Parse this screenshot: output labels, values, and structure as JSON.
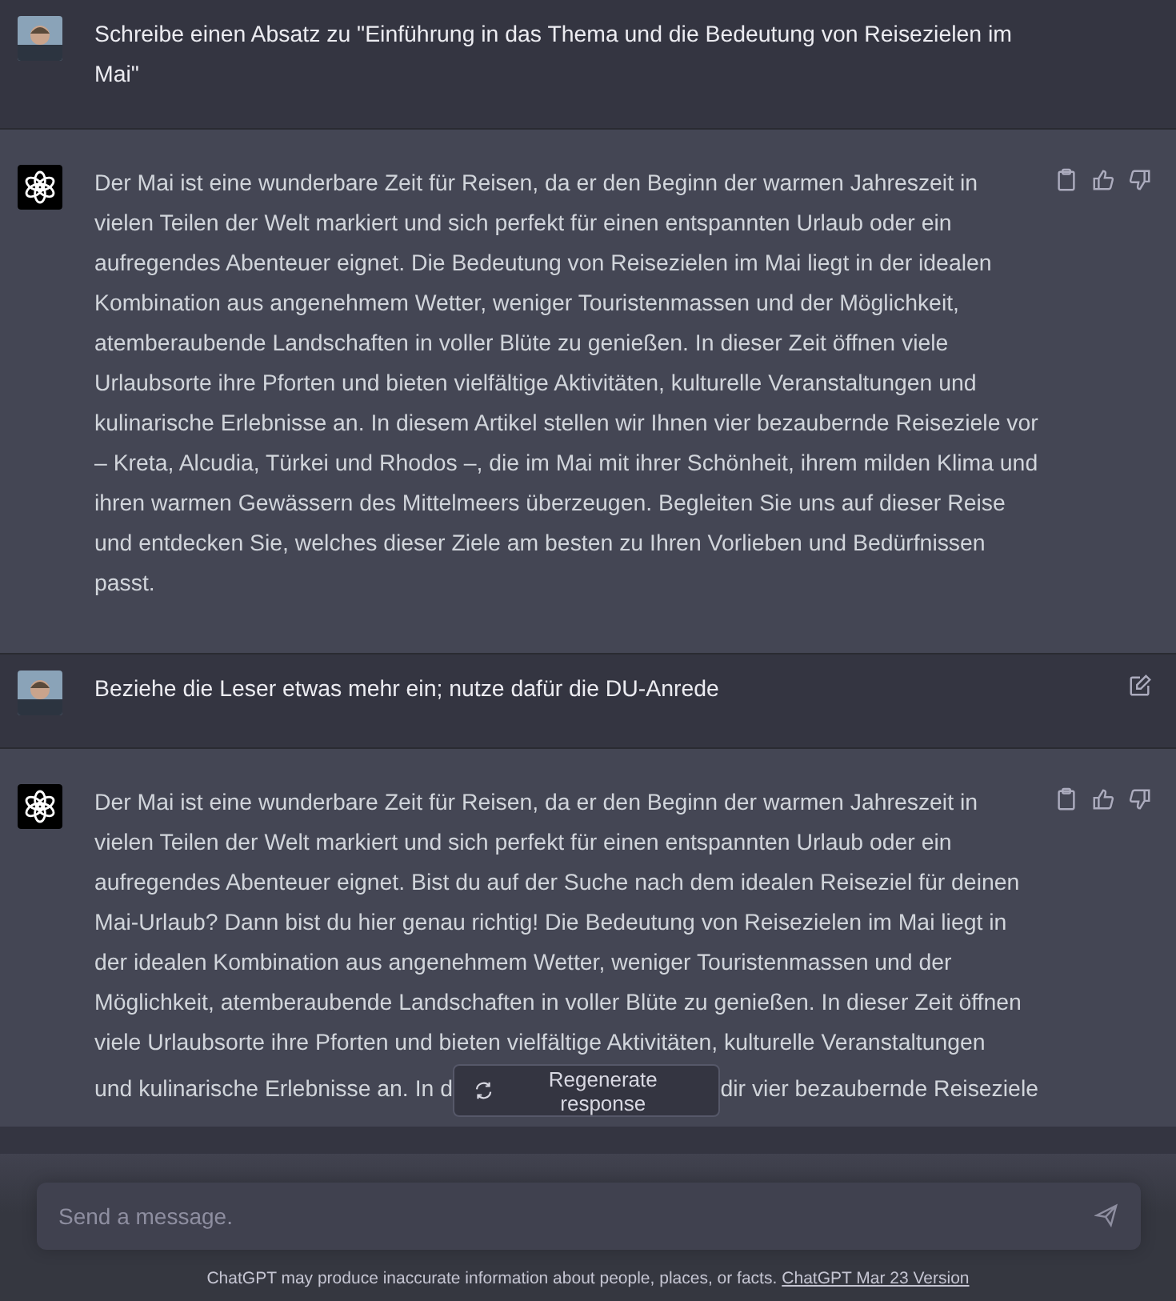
{
  "messages": [
    {
      "kind": "user",
      "text": "Schreibe einen Absatz zu \"Einführung in das Thema und die Bedeutung von Reisezielen im Mai\""
    },
    {
      "kind": "assistant",
      "text": "Der Mai ist eine wunderbare Zeit für Reisen, da er den Beginn der warmen Jahreszeit in vielen Teilen der Welt markiert und sich perfekt für einen entspannten Urlaub oder ein aufregendes Abenteuer eignet. Die Bedeutung von Reisezielen im Mai liegt in der idealen Kombination aus angenehmem Wetter, weniger Touristenmassen und der Möglichkeit, atemberaubende Landschaften in voller Blüte zu genießen. In dieser Zeit öffnen viele Urlaubsorte ihre Pforten und bieten vielfältige Aktivitäten, kulturelle Veranstaltungen und kulinarische Erlebnisse an. In diesem Artikel stellen wir Ihnen vier bezaubernde Reiseziele vor – Kreta, Alcudia, Türkei und Rhodos –, die im Mai mit ihrer Schönheit, ihrem milden Klima und ihren warmen Gewässern des Mittelmeers überzeugen. Begleiten Sie uns auf dieser Reise und entdecken Sie, welches dieser Ziele am besten zu Ihren Vorlieben und Bedürfnissen passt."
    },
    {
      "kind": "user",
      "text": "Beziehe die Leser etwas mehr ein; nutze dafür die DU-Anrede"
    },
    {
      "kind": "assistant",
      "text": "Der Mai ist eine wunderbare Zeit für Reisen, da er den Beginn der warmen Jahreszeit in vielen Teilen der Welt markiert und sich perfekt für einen entspannten Urlaub oder ein aufregendes Abenteuer eignet. Bist du auf der Suche nach dem idealen Reiseziel für deinen Mai-Urlaub? Dann bist du hier genau richtig! Die Bedeutung von Reisezielen im Mai liegt in der idealen Kombination aus angenehmem Wetter, weniger Touristenmassen und der Möglichkeit, atemberaubende Landschaften in voller Blüte zu genießen. In dieser Zeit öffnen viele Urlaubsorte ihre Pforten und bieten vielfältige Aktivitäten, kulturelle Veranstaltungen",
      "fragments": [
        "und kulinarische Erlebnisse an. In d",
        "dir vier bezaubernde Reiseziele"
      ]
    }
  ],
  "regenerate_button": "Regenerate response",
  "composer": {
    "placeholder": "Send a message."
  },
  "footer": {
    "text": "ChatGPT may produce inaccurate information about people, places, or facts.",
    "link": "ChatGPT Mar 23 Version"
  }
}
